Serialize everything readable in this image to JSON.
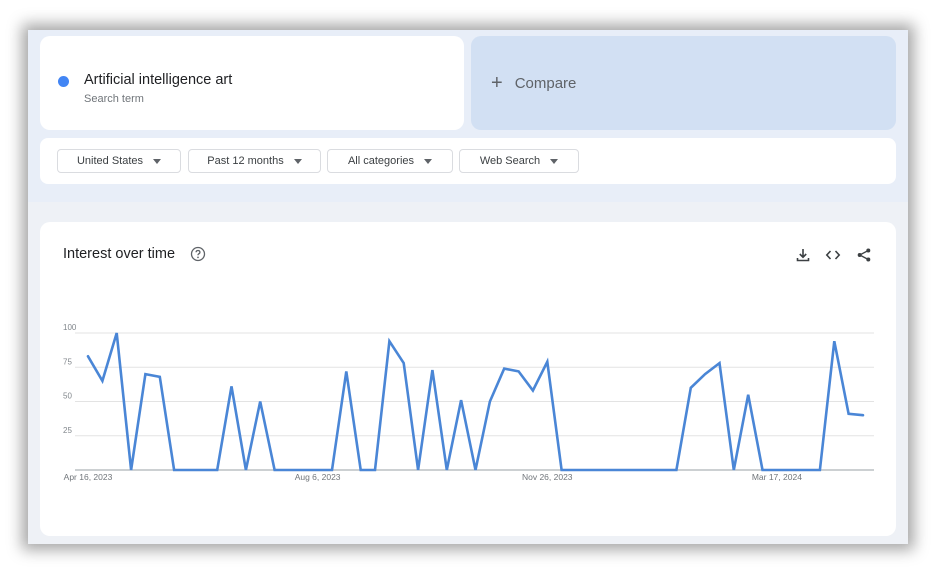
{
  "search_term": {
    "title": "Artificial intelligence art",
    "subtitle": "Search term",
    "color": "#4285f4"
  },
  "compare": {
    "plus": "+",
    "label": "Compare"
  },
  "filters": [
    {
      "label": "United States"
    },
    {
      "label": "Past 12 months"
    },
    {
      "label": "All categories"
    },
    {
      "label": "Web Search"
    }
  ],
  "card": {
    "title": "Interest over time",
    "actions": [
      "download-icon",
      "embed-code-icon",
      "share-icon"
    ]
  },
  "chart_data": {
    "type": "line",
    "color": "#4a86d6",
    "x_tick_labels": [
      "Apr 16, 2023",
      "Aug 6, 2023",
      "Nov 26, 2023",
      "Mar 17, 2024"
    ],
    "x_tick_index": [
      0,
      16,
      32,
      48
    ],
    "y_ticks": [
      25,
      50,
      75,
      100
    ],
    "ylim": [
      0,
      100
    ],
    "grid": true,
    "series": [
      {
        "values": [
          83,
          65,
          100,
          0,
          70,
          68,
          0,
          0,
          0,
          0,
          61,
          0,
          50,
          0,
          0,
          0,
          0,
          0,
          72,
          0,
          0,
          94,
          78,
          0,
          73,
          0,
          51,
          0,
          50,
          74,
          72,
          58,
          79,
          0,
          0,
          0,
          0,
          0,
          0,
          0,
          0,
          0,
          60,
          70,
          78,
          0,
          55,
          0,
          0,
          0,
          0,
          0,
          94,
          41,
          40
        ]
      }
    ]
  }
}
